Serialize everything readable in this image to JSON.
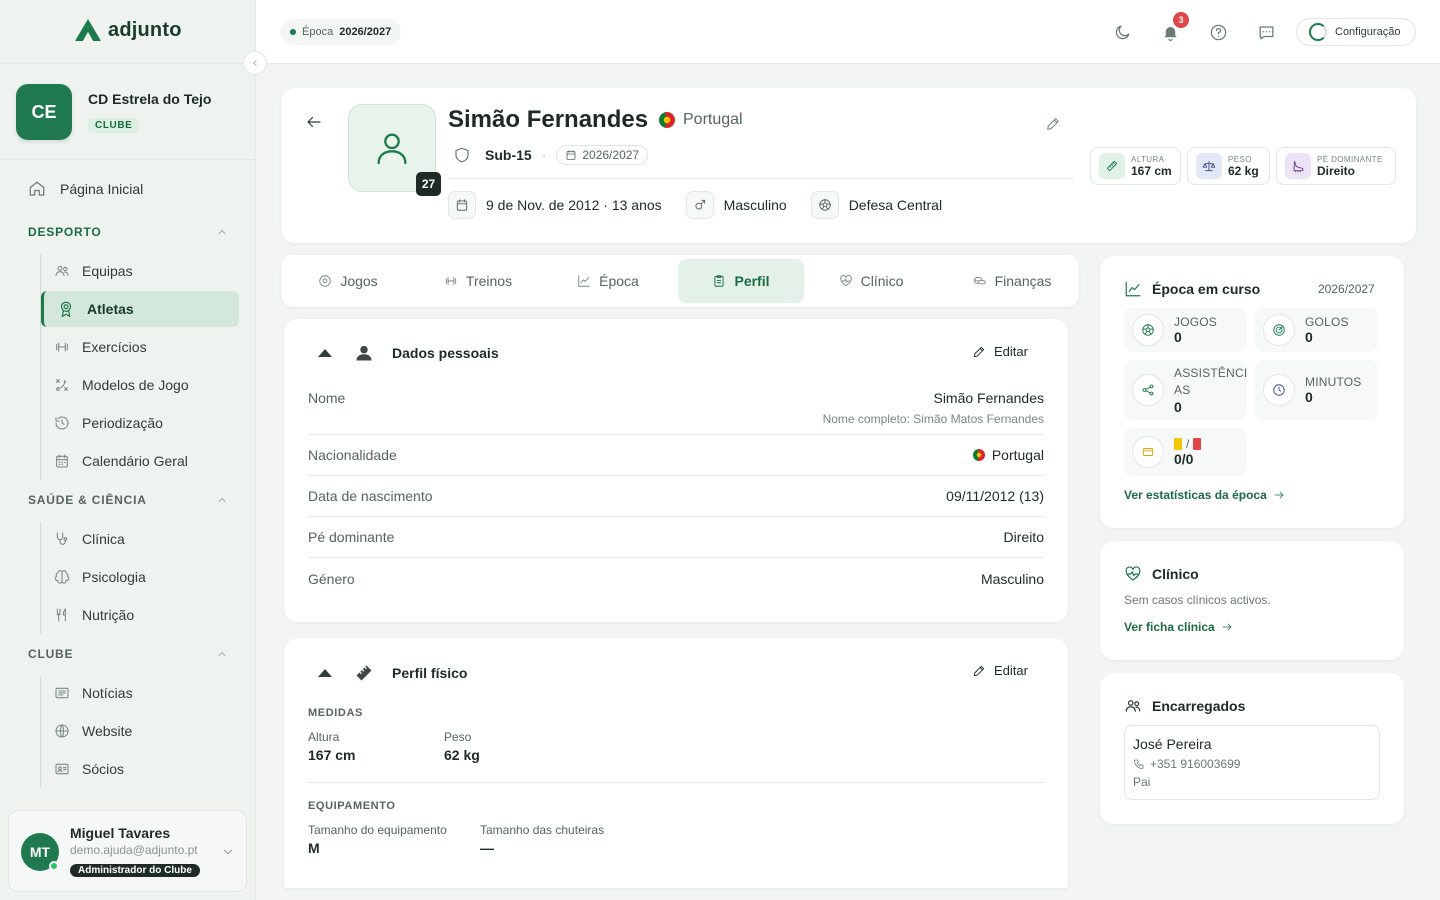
{
  "app": {
    "name": "adjunto"
  },
  "club": {
    "initials": "CE",
    "name": "CD Estrela do Tejo",
    "badge": "CLUBE"
  },
  "sidebar": {
    "home": "Página Inicial",
    "sections": [
      {
        "title": "DESPORTO",
        "items": [
          {
            "label": "Equipas",
            "icon": "users-icon"
          },
          {
            "label": "Atletas",
            "icon": "award-icon",
            "active": true
          },
          {
            "label": "Exercícios",
            "icon": "dumbbell-icon"
          },
          {
            "label": "Modelos de Jogo",
            "icon": "tactics-icon"
          },
          {
            "label": "Periodização",
            "icon": "history-icon"
          },
          {
            "label": "Calendário Geral",
            "icon": "calendar-icon"
          }
        ]
      },
      {
        "title": "SAÚDE & CIÊNCIA",
        "items": [
          {
            "label": "Clínica",
            "icon": "stethoscope-icon"
          },
          {
            "label": "Psicologia",
            "icon": "brain-icon"
          },
          {
            "label": "Nutrição",
            "icon": "utensils-icon"
          }
        ]
      },
      {
        "title": "CLUBE",
        "items": [
          {
            "label": "Notícias",
            "icon": "newspaper-icon"
          },
          {
            "label": "Website",
            "icon": "globe-icon"
          },
          {
            "label": "Sócios",
            "icon": "id-card-icon"
          }
        ]
      }
    ]
  },
  "user": {
    "initials": "MT",
    "name": "Miguel Tavares",
    "email": "demo.ajuda@adjunto.pt",
    "role": "Administrador do Clube"
  },
  "topbar": {
    "season_prefix": "Época",
    "season": "2026/2027",
    "notifications": "3",
    "config": "Configuração"
  },
  "player": {
    "name": "Simão Fernandes",
    "nationality": "Portugal",
    "jersey": "27",
    "team": "Sub-15",
    "season": "2026/2027",
    "birth": "9 de Nov. de 2012 · 13 anos",
    "gender": "Masculino",
    "position": "Defesa Central",
    "metrics": [
      {
        "label": "ALTURA",
        "value": "167 cm"
      },
      {
        "label": "PESO",
        "value": "62 kg"
      },
      {
        "label": "PÉ DOMINANTE",
        "value": "Direito"
      }
    ]
  },
  "tabs": [
    "Jogos",
    "Treinos",
    "Época",
    "Perfil",
    "Clínico",
    "Finanças"
  ],
  "personal": {
    "title": "Dados pessoais",
    "edit": "Editar",
    "rows": [
      {
        "k": "Nome",
        "v": "Simão Fernandes",
        "note": "Nome completo: Simão Matos Fernandes"
      },
      {
        "k": "Nacionalidade",
        "v": "Portugal"
      },
      {
        "k": "Data de nascimento",
        "v": "09/11/2012 (13)"
      },
      {
        "k": "Pé dominante",
        "v": "Direito"
      },
      {
        "k": "Género",
        "v": "Masculino"
      }
    ]
  },
  "physical": {
    "title": "Perfil físico",
    "edit": "Editar",
    "measures_label": "MEDIDAS",
    "height_label": "Altura",
    "height": "167 cm",
    "weight_label": "Peso",
    "weight": "62 kg",
    "equipment_label": "EQUIPAMENTO",
    "kit_label": "Tamanho do equipamento",
    "kit": "M",
    "boots_label": "Tamanho das chuteiras",
    "boots": "—"
  },
  "season_card": {
    "title": "Época em curso",
    "season": "2026/2027",
    "games_label": "JOGOS",
    "games": "0",
    "goals_label": "GOLOS",
    "goals": "0",
    "assists_label": "ASSISTÊNCI AS",
    "assists": "0",
    "minutes_label": "MINUTOS",
    "minutes": "0",
    "cards_sep": "/",
    "cards": "0/0",
    "link": "Ver estatísticas da época"
  },
  "clinical": {
    "title": "Clínico",
    "text": "Sem casos clínicos activos.",
    "link": "Ver ficha clínica"
  },
  "guardians": {
    "title": "Encarregados",
    "name": "José Pereira",
    "phone": "+351 916003699",
    "relation": "Pai"
  }
}
